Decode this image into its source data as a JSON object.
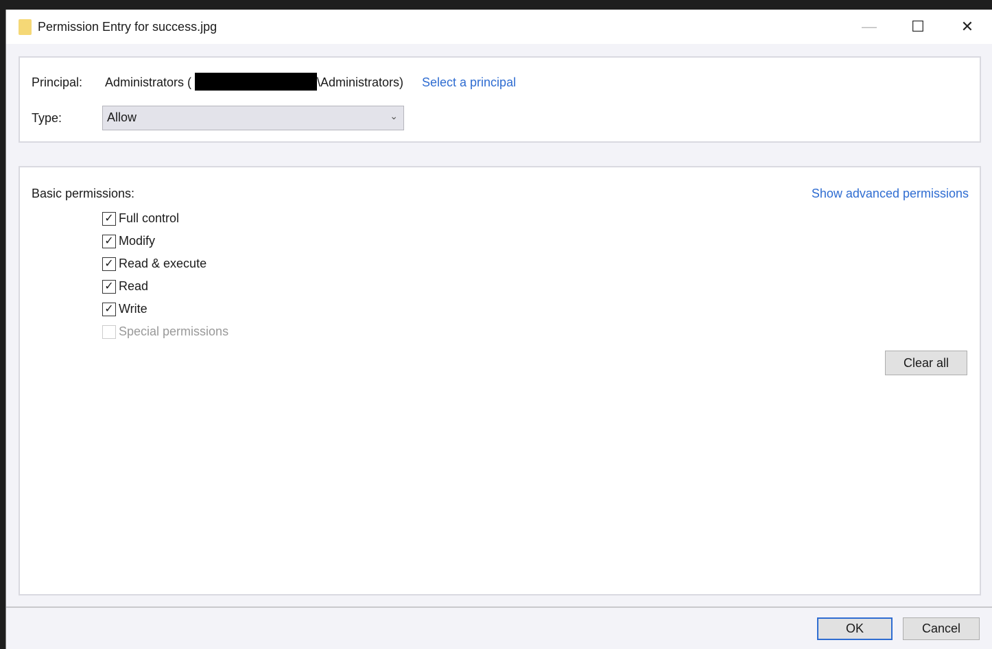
{
  "window": {
    "title": "Permission Entry for success.jpg",
    "minimize": "—",
    "maximize": "☐",
    "close": "✕"
  },
  "principal": {
    "label": "Principal:",
    "name_prefix": "Administrators (",
    "name_suffix": "\\Administrators)",
    "select_link": "Select a principal"
  },
  "type": {
    "label": "Type:",
    "value": "Allow",
    "chevron": "⌄"
  },
  "permissions": {
    "label": "Basic permissions:",
    "advanced_link": "Show advanced permissions",
    "items": [
      {
        "label": "Full control",
        "checked": true
      },
      {
        "label": "Modify",
        "checked": true
      },
      {
        "label": "Read & execute",
        "checked": true
      },
      {
        "label": "Read",
        "checked": true
      },
      {
        "label": "Write",
        "checked": true
      },
      {
        "label": "Special permissions",
        "checked": false,
        "disabled": true
      }
    ],
    "clear_all": "Clear all"
  },
  "footer": {
    "ok": "OK",
    "cancel": "Cancel"
  },
  "check_glyph": "✓"
}
